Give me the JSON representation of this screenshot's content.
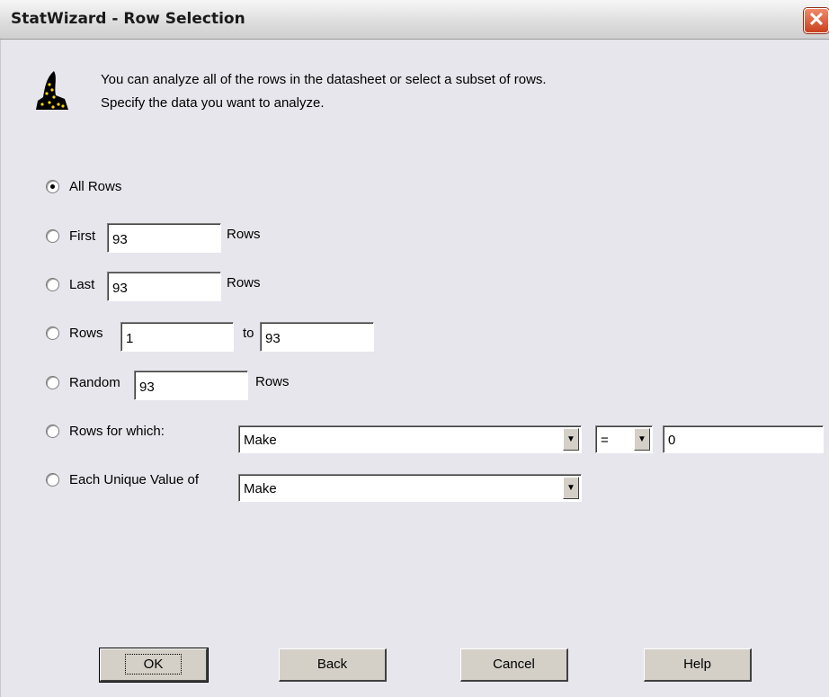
{
  "window": {
    "title": "StatWizard - Row Selection",
    "close_glyph": "✕"
  },
  "intro": {
    "line1": "You can analyze all of the rows in the datasheet or select a subset of rows.",
    "line2": "Specify the data you want to analyze."
  },
  "options": {
    "all_rows": {
      "label": "All Rows",
      "selected": true
    },
    "first": {
      "label": "First",
      "value": "93",
      "suffix": "Rows"
    },
    "last": {
      "label": "Last",
      "value": "93",
      "suffix": "Rows"
    },
    "range": {
      "label": "Rows",
      "from": "1",
      "to_label": "to",
      "to": "93"
    },
    "random": {
      "label": "Random",
      "value": "93",
      "suffix": "Rows"
    },
    "rows_for_which": {
      "label": "Rows for which:",
      "variable": "Make",
      "operator": "=",
      "value": "0"
    },
    "each_unique": {
      "label": "Each Unique Value of",
      "variable": "Make"
    }
  },
  "buttons": {
    "ok": "OK",
    "back": "Back",
    "cancel": "Cancel",
    "help": "Help"
  },
  "icons": {
    "wizard": "wizard-hat-icon",
    "dropdown": "chevron-down-icon"
  }
}
